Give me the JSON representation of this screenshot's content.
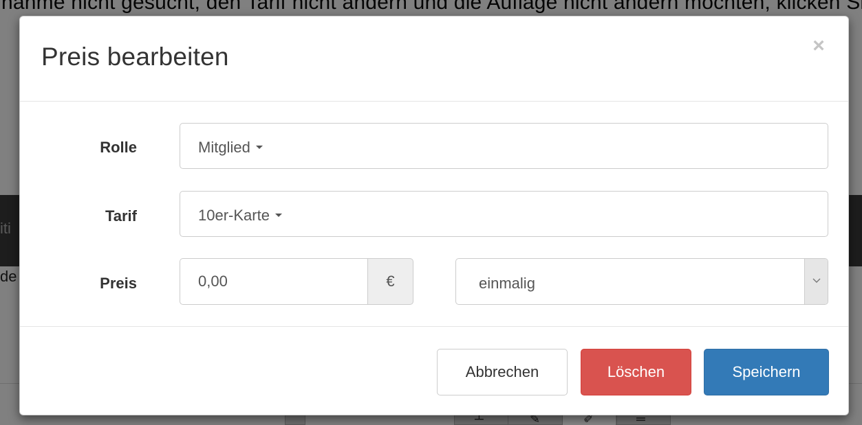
{
  "background": {
    "top_text": "nahme nicht gesucht, den Tarif nicht ändern und die Auflage nicht ändern möchten, klicken Sie auf Übernehmen und tragen Sie",
    "left_fragment_1": "iti",
    "left_fragment_2": "de"
  },
  "modal": {
    "title": "Preis bearbeiten",
    "close_symbol": "×",
    "fields": {
      "role_label": "Rolle",
      "role_value": "Mitglied",
      "tariff_label": "Tarif",
      "tariff_value": "10er-Karte",
      "price_label": "Preis",
      "price_value": "0,00",
      "currency": "€",
      "frequency_value": "einmalig"
    },
    "footer": {
      "cancel_label": "Abbrechen",
      "delete_label": "Löschen",
      "save_label": "Speichern"
    }
  },
  "colors": {
    "danger": "#d9534f",
    "primary": "#337ab7",
    "backdrop": "#808080"
  },
  "icons": [
    "close-icon",
    "caret-down-icon",
    "chevron-down-icon",
    "plus-icon",
    "pencil-icon",
    "edit-icon",
    "trash-icon"
  ]
}
